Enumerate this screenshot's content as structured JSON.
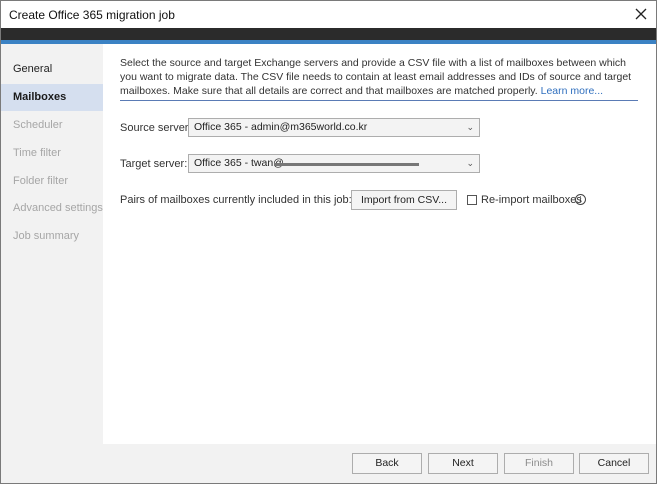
{
  "window": {
    "title": "Create Office 365 migration job"
  },
  "sidebar": {
    "items": [
      {
        "label": "General"
      },
      {
        "label": "Mailboxes"
      },
      {
        "label": "Scheduler"
      },
      {
        "label": "Time filter"
      },
      {
        "label": "Folder filter"
      },
      {
        "label": "Advanced settings"
      },
      {
        "label": "Job summary"
      }
    ]
  },
  "main": {
    "description": "Select the source and target Exchange servers and provide a CSV file with a list of mailboxes between which you want to migrate data. The CSV file needs to contain at least email addresses and IDs of source and target mailboxes. Make sure that all details are correct and that mailboxes are matched properly.",
    "learn_more": "Learn more...",
    "source_label": "Source server:",
    "source_value": "Office 365 - admin@m365world.co.kr",
    "target_label": "Target server:",
    "target_value": "Office 365 - twan@",
    "pairs_label": "Pairs of mailboxes currently included in this job: 0",
    "import_button": "Import from CSV...",
    "reimport_label": "Re-import mailboxes"
  },
  "footer": {
    "back": "Back",
    "next": "Next",
    "finish": "Finish",
    "cancel": "Cancel"
  },
  "colors": {
    "accent": "#3b82c4",
    "active_nav": "#d5dfef",
    "link": "#2f6fbe"
  }
}
